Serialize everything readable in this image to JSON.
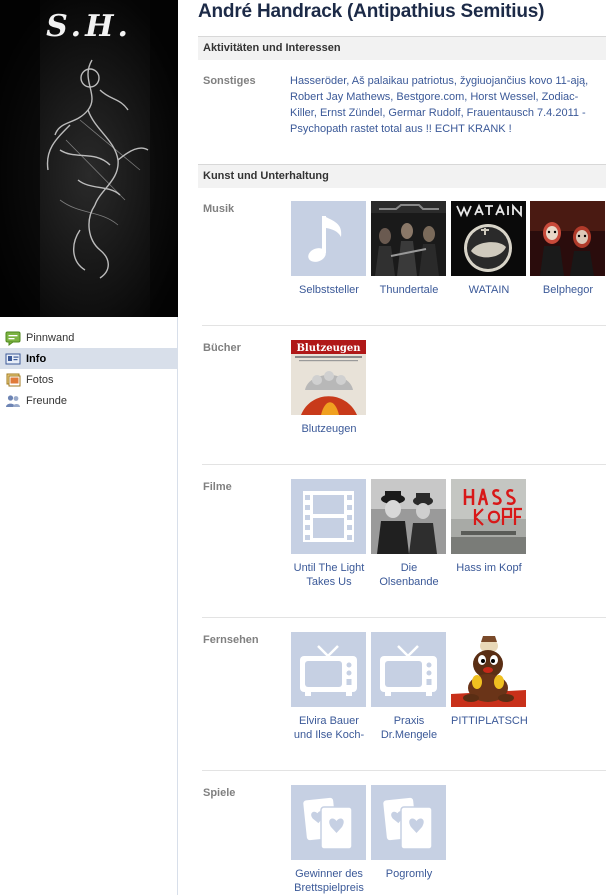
{
  "profile": {
    "name": "André Handrack (Antipathius Semitius)",
    "picture_text": "S.H."
  },
  "nav": [
    {
      "label": "Pinnwand",
      "icon": "wall-icon",
      "active": false
    },
    {
      "label": "Info",
      "icon": "info-icon",
      "active": true
    },
    {
      "label": "Fotos",
      "icon": "photos-icon",
      "active": false
    },
    {
      "label": "Freunde",
      "icon": "friends-icon",
      "active": false
    }
  ],
  "activities": {
    "heading": "Aktivitäten und Interessen",
    "label": "Sonstiges",
    "text": "Hasseröder, Aš palaikau patriotus, žygiuojančius kovo 11-ają, Robert Jay Mathews, Bestgore.com, Horst Wessel, Zodiac-Killer, Ernst Zündel, Germar Rudolf, Frauentausch 7.4.2011 - Psychopath rastet total aus !! ECHT KRANK !"
  },
  "entertainment": {
    "heading": "Kunst und Unterhaltung",
    "music": {
      "label": "Musik",
      "items": [
        {
          "label": "Selbststeller",
          "thumb": "music-note-icon"
        },
        {
          "label": "Thundertale",
          "thumb": "band-photo"
        },
        {
          "label": "WATAIN",
          "thumb": "logo-image"
        },
        {
          "label": "Belphegor",
          "thumb": "band-photo"
        }
      ]
    },
    "books": {
      "label": "Bücher",
      "items": [
        {
          "label": "Blutzeugen",
          "thumb": "book-cover"
        }
      ]
    },
    "films": {
      "label": "Filme",
      "items": [
        {
          "label": "Until The Light Takes Us",
          "thumb": "film-strip-icon"
        },
        {
          "label": "Die Olsenbande",
          "thumb": "movie-still"
        },
        {
          "label": "Hass im Kopf",
          "thumb": "movie-poster"
        }
      ]
    },
    "tv": {
      "label": "Fernsehen",
      "items": [
        {
          "label": "Elvira Bauer und Ilse Koch-",
          "thumb": "tv-icon"
        },
        {
          "label": "Praxis Dr.Mengele",
          "thumb": "tv-icon"
        },
        {
          "label": "PITTIPLATSCH",
          "thumb": "puppet-photo"
        }
      ]
    },
    "games": {
      "label": "Spiele",
      "items": [
        {
          "label": "Gewinner des Brettspielpreis",
          "thumb": "playing-cards-icon"
        },
        {
          "label": "Pogromly",
          "thumb": "playing-cards-icon"
        }
      ]
    }
  },
  "colors": {
    "link": "#3b5998",
    "title": "#1c2a47",
    "label_gray": "#808080",
    "placeholder_bg": "#c6d0e3",
    "nav_active_bg": "#d8dfea"
  }
}
